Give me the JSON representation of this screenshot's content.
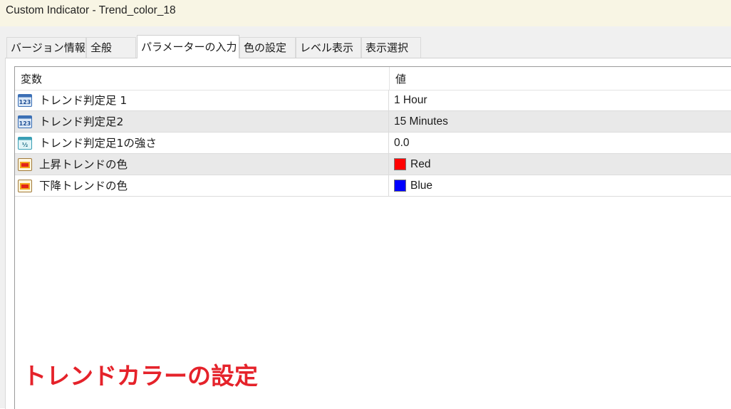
{
  "window": {
    "title": "Custom Indicator - Trend_color_18"
  },
  "tabs": [
    {
      "label": "バージョン情報"
    },
    {
      "label": "全般"
    },
    {
      "label": "パラメーターの入力",
      "active": true
    },
    {
      "label": "色の設定"
    },
    {
      "label": "レベル表示"
    },
    {
      "label": "表示選択"
    }
  ],
  "table": {
    "columns": [
      "変数",
      "値"
    ],
    "rows": [
      {
        "icon": "integer-icon",
        "label": "トレンド判定足 1",
        "value": "1 Hour"
      },
      {
        "icon": "integer-icon",
        "label": "トレンド判定足2",
        "value": "15 Minutes"
      },
      {
        "icon": "double-icon",
        "label": "トレンド判定足1の強さ",
        "value": "0.0"
      },
      {
        "icon": "color-icon",
        "label": "上昇トレンドの色",
        "value": "Red",
        "swatch": "#ff0000"
      },
      {
        "icon": "color-icon",
        "label": "下降トレンドの色",
        "value": "Blue",
        "swatch": "#0000ff"
      }
    ]
  },
  "annotation": {
    "text": "トレンドカラーの設定",
    "color": "#e5222a"
  }
}
